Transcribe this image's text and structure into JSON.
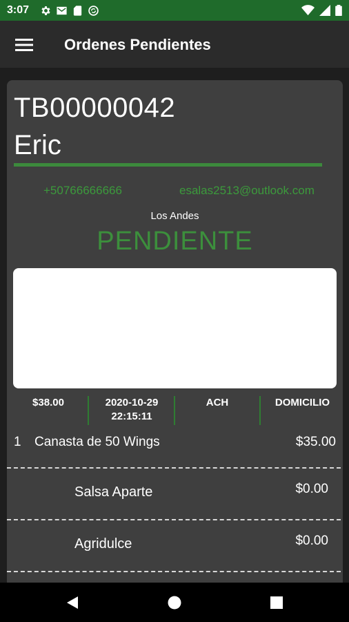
{
  "status_bar": {
    "time": "3:07",
    "left_icons": [
      "gear-icon",
      "mail-icon",
      "sd-card-icon",
      "sync-icon"
    ],
    "right_icons": [
      "wifi-icon",
      "signal-icon",
      "battery-icon"
    ]
  },
  "app_bar": {
    "title": "Ordenes Pendientes",
    "menu_icon": "hamburger-menu-icon"
  },
  "order": {
    "id": "TB00000042",
    "customer": "Eric",
    "phone": "+50766666666",
    "email": "esalas2513@outlook.com",
    "location": "Los Andes",
    "status": "PENDIENTE",
    "summary": {
      "total": "$38.00",
      "date": "2020-10-29",
      "time": "22:15:11",
      "payment": "ACH",
      "delivery": "DOMICILIO"
    },
    "items": [
      {
        "qty": "1",
        "name": "Canasta de 50 Wings",
        "price": "$35.00"
      }
    ],
    "modifiers": [
      {
        "name": "Salsa Aparte",
        "price": "$0.00"
      },
      {
        "name": "Agridulce",
        "price": "$0.00"
      }
    ]
  },
  "colors": {
    "status_bar": "#1f6b2b",
    "accent_green": "#3c8a3c",
    "card": "#3f3f3f",
    "background": "#1e1e1e"
  },
  "nav_bar": {
    "icons": [
      "back-icon",
      "home-icon",
      "recents-icon"
    ]
  }
}
